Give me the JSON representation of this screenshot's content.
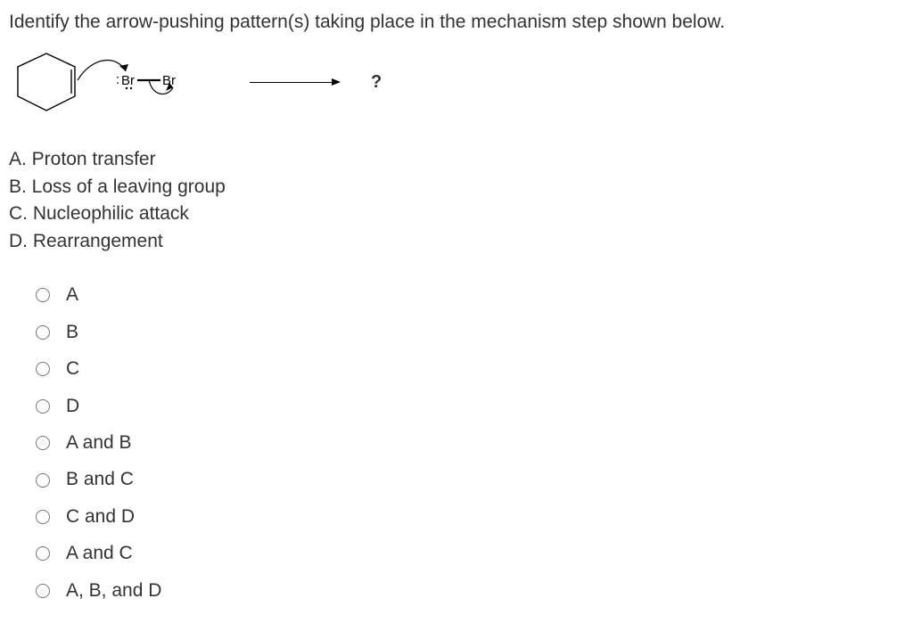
{
  "question": "Identify the arrow-pushing pattern(s) taking place in the mechanism step shown below.",
  "product_placeholder": "?",
  "br_label_left": ":Br",
  "br_label_right": "Br",
  "patterns": {
    "a": "A. Proton transfer",
    "b": "B. Loss of a leaving group",
    "c": "C. Nucleophilic attack",
    "d": "D. Rearrangement"
  },
  "options": {
    "o1": "A",
    "o2": "B",
    "o3": "C",
    "o4": "D",
    "o5": "A and B",
    "o6": "B and C",
    "o7": "C and D",
    "o8": "A and C",
    "o9": "A, B, and D"
  }
}
